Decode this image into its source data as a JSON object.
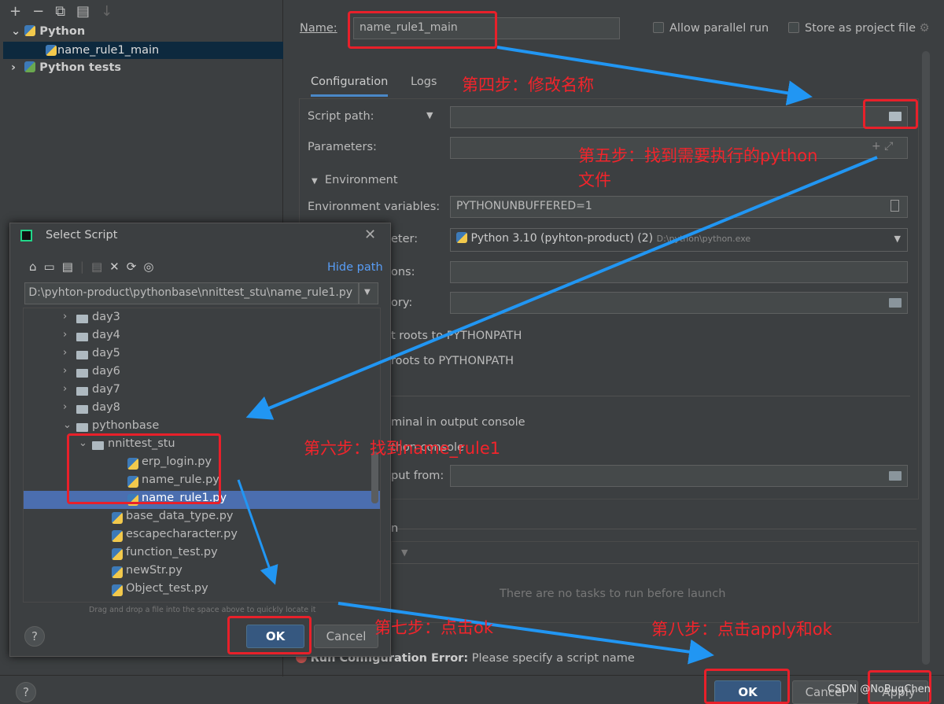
{
  "left_panel": {
    "toolbar": [
      "+",
      "−",
      "⧉",
      "▤",
      "↓"
    ],
    "items": [
      {
        "label": "Python",
        "expanded": true,
        "bold": true
      },
      {
        "label": "name_rule1_main",
        "selected": true
      },
      {
        "label": "Python tests",
        "expanded": false,
        "bold": true
      }
    ]
  },
  "config": {
    "name_label": "Name:",
    "name_value": "name_rule1_main",
    "allow_parallel": "Allow parallel run",
    "store_project": "Store as project file",
    "tabs": [
      "Configuration",
      "Logs"
    ],
    "script_path_label": "Script path:",
    "parameters_label": "Parameters:",
    "environment_label": "Environment",
    "env_vars_label": "Environment variables:",
    "env_vars_value": "PYTHONUNBUFFERED=1",
    "interpreter_label_partial": "eter:",
    "interpreter_value": "Python 3.10 (pyhton-product) (2)",
    "interpreter_path": "D:\\python\\python.exe",
    "interp_options_partial": "ons:",
    "working_dir_partial": "ory:",
    "content_roots_partial": "t roots to PYTHONPATH",
    "source_roots_partial": "roots to PYTHONPATH",
    "emulate_partial": "minal in output console",
    "python_console_partial": "thon console",
    "redirect_partial": "put from:",
    "before_launch_partial": "n",
    "no_tasks": "There are no tasks to run before launch",
    "error_label": "Run Configuration Error:",
    "error_text": "Please specify a script name",
    "ok": "OK",
    "cancel": "Cancel",
    "apply": "Apply",
    "help": "?"
  },
  "dialog": {
    "title": "Select Script",
    "hide_path": "Hide path",
    "path_value": "D:\\pyhton-product\\pythonbase\\nnittest_stu\\name_rule1.py",
    "tree": [
      {
        "label": "day3",
        "type": "folder",
        "level": 0,
        "chevron": "right"
      },
      {
        "label": "day4",
        "type": "folder",
        "level": 0,
        "chevron": "right"
      },
      {
        "label": "day5",
        "type": "folder",
        "level": 0,
        "chevron": "right"
      },
      {
        "label": "day6",
        "type": "folder",
        "level": 0,
        "chevron": "right"
      },
      {
        "label": "day7",
        "type": "folder",
        "level": 0,
        "chevron": "right"
      },
      {
        "label": "day8",
        "type": "folder",
        "level": 0,
        "chevron": "right"
      },
      {
        "label": "pythonbase",
        "type": "folder",
        "level": 0,
        "chevron": "down"
      },
      {
        "label": "nnittest_stu",
        "type": "folder",
        "level": 1,
        "chevron": "down"
      },
      {
        "label": "erp_login.py",
        "type": "file",
        "level": 2
      },
      {
        "label": "name_rule.py",
        "type": "file",
        "level": 2
      },
      {
        "label": "name_rule1.py",
        "type": "file",
        "level": 2,
        "selected": true
      },
      {
        "label": "base_data_type.py",
        "type": "file",
        "level": 1
      },
      {
        "label": "escapecharacter.py",
        "type": "file",
        "level": 1
      },
      {
        "label": "function_test.py",
        "type": "file",
        "level": 1
      },
      {
        "label": "newStr.py",
        "type": "file",
        "level": 1
      },
      {
        "label": "Object_test.py",
        "type": "file",
        "level": 1
      }
    ],
    "hint": "Drag and drop a file into the space above to quickly locate it",
    "ok": "OK",
    "cancel": "Cancel",
    "help": "?"
  },
  "annotations": {
    "step4": "第四步：修改名称",
    "step5a": "第五步：找到需要执行的python",
    "step5b": "文件",
    "step6": "第六步：找到name_rule1",
    "step7": "第七步：点击ok",
    "step8": "第八步：点击apply和ok",
    "watermark": "CSDN @NoBugChen"
  },
  "colors": {
    "annotation_red": "#e8202a",
    "arrow_blue": "#2196f3",
    "selection": "#4b6eaf",
    "primary_button": "#365880"
  }
}
